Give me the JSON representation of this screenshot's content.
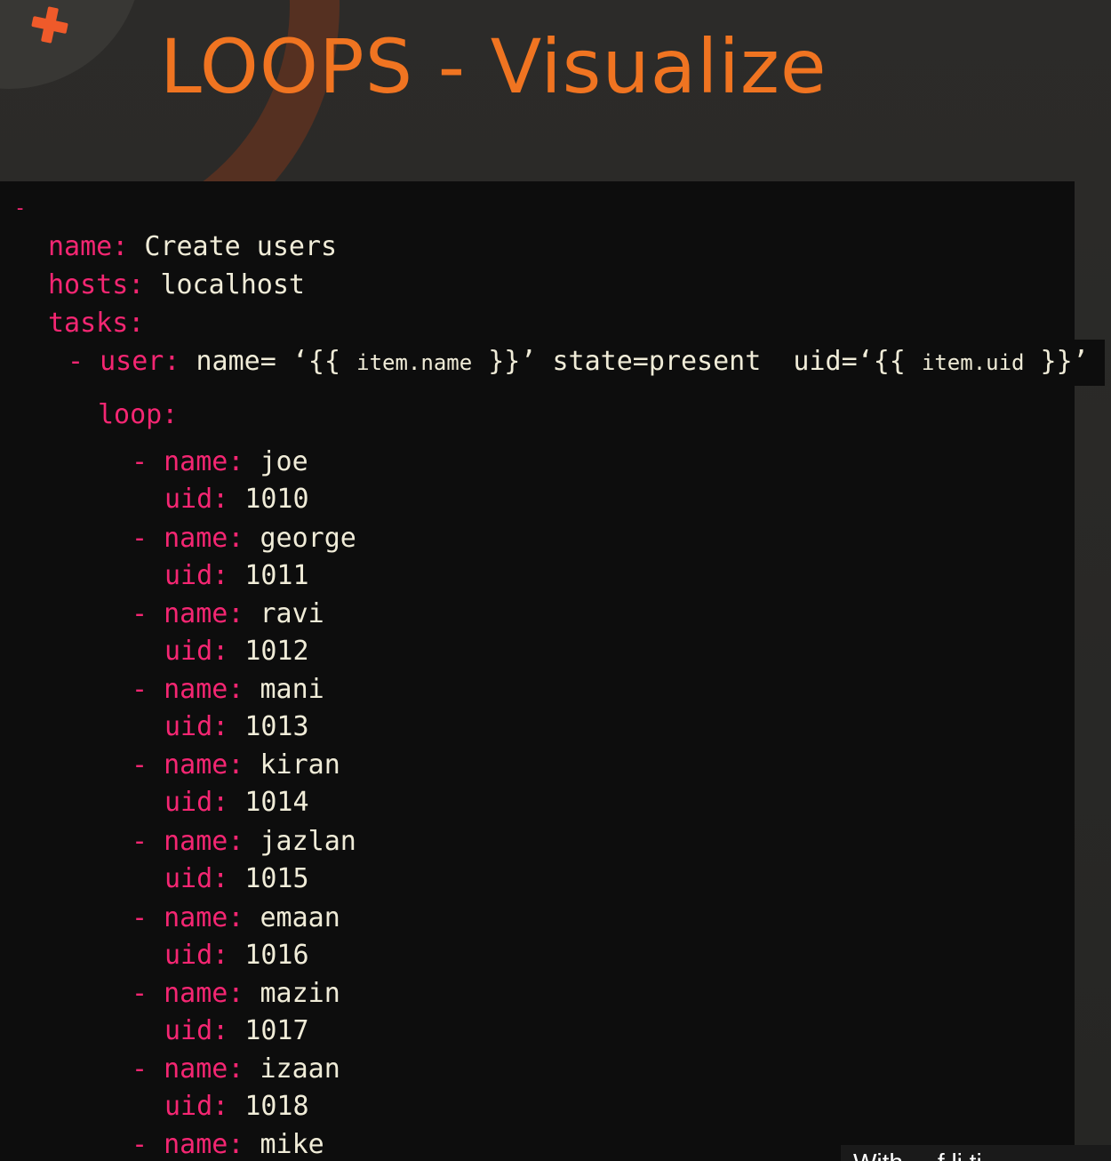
{
  "slide": {
    "title": "LOOPS - Visualize"
  },
  "code": {
    "leading_dash": "-",
    "play_name_key": "name:",
    "play_name_value": "Create users",
    "hosts_key": "hosts:",
    "hosts_value": "localhost",
    "tasks_key": "tasks:",
    "task_dash": "-",
    "task_module_key": "user:",
    "task_args_part1": "name= ‘{{ ",
    "task_args_item_name": "item.name",
    "task_args_part2": " }}’ state=present  uid=‘{{ ",
    "task_args_item_uid": "item.uid",
    "task_args_part3": " }}’",
    "loop_key": "loop:",
    "item_dash": "-",
    "item_name_key": "name:",
    "item_uid_key": "uid:",
    "items": [
      {
        "name": "joe",
        "uid": "1010"
      },
      {
        "name": "george",
        "uid": "1011"
      },
      {
        "name": "ravi",
        "uid": "1012"
      },
      {
        "name": "mani",
        "uid": "1013"
      },
      {
        "name": "kiran",
        "uid": "1014"
      },
      {
        "name": "jazlan",
        "uid": "1015"
      },
      {
        "name": "emaan",
        "uid": "1016"
      },
      {
        "name": "mazin",
        "uid": "1017"
      },
      {
        "name": "izaan",
        "uid": "1018"
      },
      {
        "name": "mike",
        "uid": ""
      }
    ]
  },
  "caption": {
    "text": "With ... f li ti"
  },
  "colors": {
    "title": "#f07421",
    "yaml_key": "#f42672",
    "yaml_value": "#f0ecd8",
    "code_background": "#0d0d0d",
    "plus_icon": "#ef5a2a"
  },
  "icons": {
    "corner": "plus-icon"
  }
}
